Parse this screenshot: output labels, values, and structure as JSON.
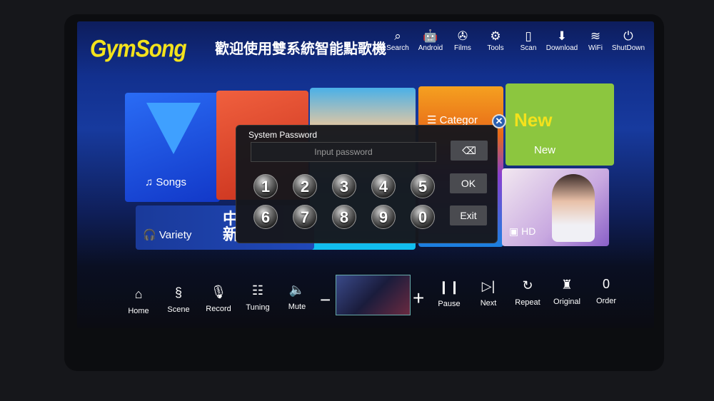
{
  "header": {
    "logo": "GymSong",
    "title": "歡迎使用雙系統智能點歌機",
    "icons": [
      {
        "label": "Search",
        "icon": "search-icon",
        "g": "⌕"
      },
      {
        "label": "Android",
        "icon": "android-icon",
        "g": "🤖"
      },
      {
        "label": "Films",
        "icon": "film-reel-icon",
        "g": "✇"
      },
      {
        "label": "Tools",
        "icon": "gear-icon",
        "g": "⚙"
      },
      {
        "label": "Scan",
        "icon": "phone-icon",
        "g": "▯"
      },
      {
        "label": "Download",
        "icon": "download-icon",
        "g": "⬇"
      },
      {
        "label": "WiFi",
        "icon": "wifi-icon",
        "g": "≋"
      },
      {
        "label": "ShutDown",
        "icon": "power-icon",
        "g": "⏻"
      }
    ]
  },
  "tiles": {
    "songs": "Songs",
    "category": "Categor",
    "new_big": "New",
    "new": "New",
    "variety": "Variety",
    "variety_cn": "中 新",
    "hd": "HD"
  },
  "dialog": {
    "title": "System Password",
    "placeholder": "Input password",
    "ok": "OK",
    "exit": "Exit",
    "backspace": "⌫",
    "close": "✕",
    "keys": [
      "1",
      "2",
      "3",
      "4",
      "5",
      "6",
      "7",
      "8",
      "9",
      "0"
    ]
  },
  "bottom": {
    "left": [
      {
        "label": "Home",
        "icon": "home-icon",
        "g": "⌂"
      },
      {
        "label": "Scene",
        "icon": "scene-icon",
        "g": "§"
      },
      {
        "label": "Record",
        "icon": "microphone-icon",
        "g": "🎙"
      },
      {
        "label": "Tuning",
        "icon": "tuning-icon",
        "g": "☷"
      },
      {
        "label": "Mute",
        "icon": "speaker-icon",
        "g": "🔈"
      }
    ],
    "minus": "−",
    "plus": "+",
    "right": [
      {
        "label": "Pause",
        "icon": "pause-icon",
        "g": "❙❙"
      },
      {
        "label": "Next",
        "icon": "next-icon",
        "g": "▷|"
      },
      {
        "label": "Repeat",
        "icon": "repeat-icon",
        "g": "↻"
      },
      {
        "label": "Original",
        "icon": "original-vocal-icon",
        "g": "♜"
      },
      {
        "label": "Order",
        "icon": "order-count-icon",
        "g": "0"
      }
    ]
  },
  "colors": {
    "logo": "#f3e21c",
    "songs_tile": "#1a4fe0",
    "red_tile": "#e0452e",
    "orange_tile": "#f28a1a",
    "new_tile": "#8cc63f"
  }
}
